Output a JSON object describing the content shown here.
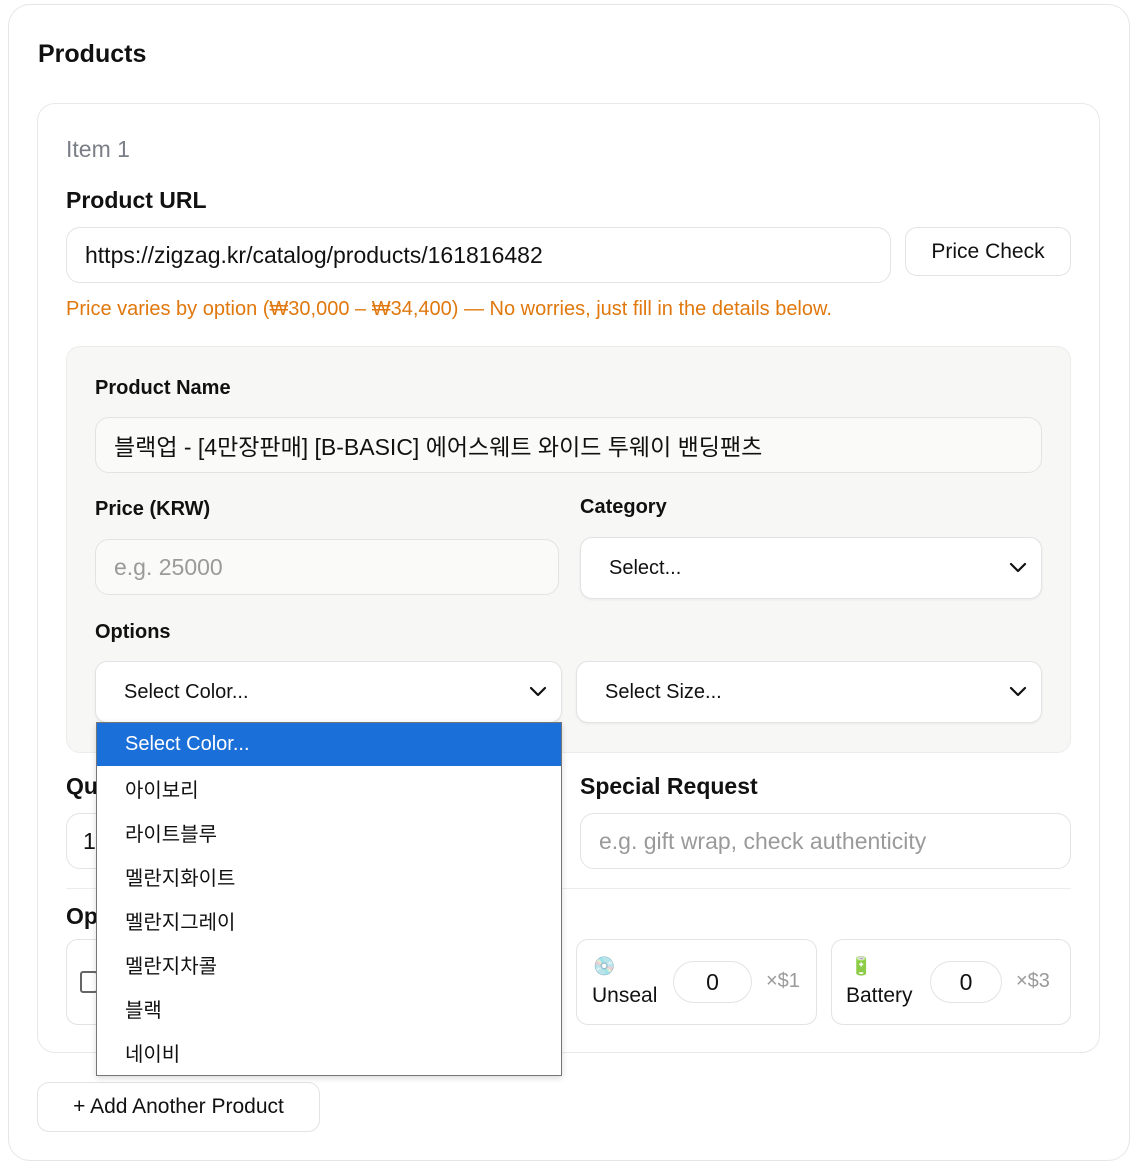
{
  "section": {
    "title": "Products"
  },
  "item": {
    "label": "Item 1",
    "product_url_label": "Product URL",
    "product_url_value": "https://zigzag.kr/catalog/products/161816482",
    "price_check_label": "Price Check",
    "price_warning": "Price varies by option (₩30,000 – ₩34,400) — No worries, just fill in the details below.",
    "product_name_label": "Product Name",
    "product_name_value": "블랙업 - [4만장판매] [B-BASIC] 에어스웨트 와이드 투웨이 밴딩팬츠",
    "price_label": "Price (KRW)",
    "price_placeholder": "e.g. 25000",
    "category_label": "Category",
    "category_value": "Select...",
    "options_label": "Options",
    "color_select_value": "Select Color...",
    "size_select_value": "Select Size...",
    "quantity_label_visible": "Qu",
    "quantity_value_visible": "1",
    "special_request_label": "Special Request",
    "special_request_placeholder": "e.g. gift wrap, check authenticity",
    "optional_label_visible": "Op"
  },
  "addons": [
    {
      "icon": "disc-icon",
      "glyph": "💿",
      "label": "Unseal",
      "count": "0",
      "price": "×$1"
    },
    {
      "icon": "battery-icon",
      "glyph": "🔋",
      "label": "Battery",
      "count": "0",
      "price": "×$3"
    }
  ],
  "color_dropdown": {
    "options": [
      "Select Color...",
      "아이보리",
      "라이트블루",
      "멜란지화이트",
      "멜란지그레이",
      "멜란지차콜",
      "블랙",
      "네이비"
    ],
    "selected_index": 0
  },
  "add_product_label": "+ Add Another Product",
  "colors": {
    "warning": "#e0780e",
    "selected": "#1a6fd8"
  }
}
